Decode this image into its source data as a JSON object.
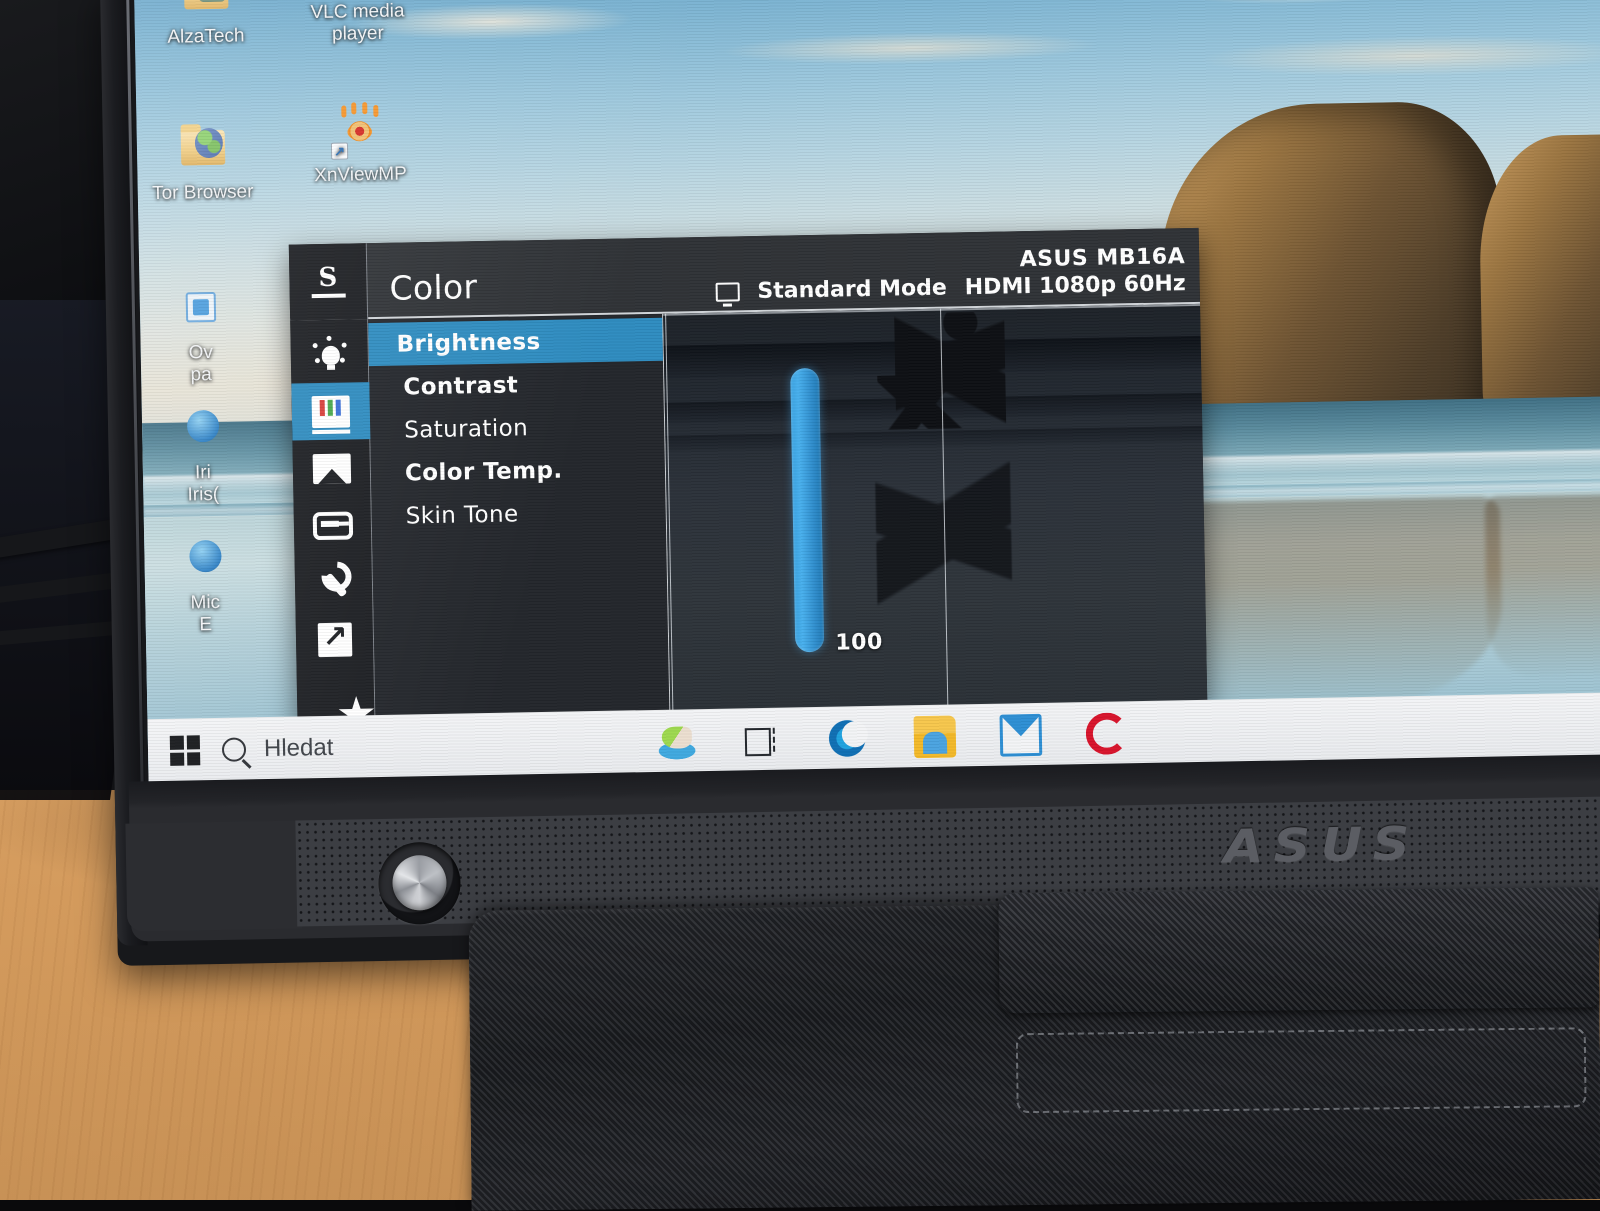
{
  "device": {
    "brand_logo": "ASUS",
    "model_label": "ASUS MB16A"
  },
  "osd": {
    "title": "Color",
    "picture_mode": "Standard Mode",
    "signal": "HDMI  1080p 60Hz",
    "monitor_icon": "monitor-icon",
    "splendid_icon": "s-splendid-icon",
    "rail": [
      {
        "name": "eyecare",
        "icon": "lightbulb-icon",
        "active": false
      },
      {
        "name": "color",
        "icon": "rgb-bars-icon",
        "active": true
      },
      {
        "name": "image",
        "icon": "picture-icon",
        "active": false
      },
      {
        "name": "input-select",
        "icon": "input-arrow-icon",
        "active": false
      },
      {
        "name": "system-setup",
        "icon": "wrench-icon",
        "active": false
      },
      {
        "name": "shortcut",
        "icon": "arrow-up-right-icon",
        "active": false
      },
      {
        "name": "myfavorite",
        "icon": "star-icon",
        "active": false
      }
    ],
    "menu": [
      {
        "label": "Brightness",
        "selected": true,
        "dim": false
      },
      {
        "label": "Contrast",
        "selected": false,
        "dim": false
      },
      {
        "label": "Saturation",
        "selected": false,
        "dim": true
      },
      {
        "label": "Color Temp.",
        "selected": false,
        "dim": false
      },
      {
        "label": "Skin Tone",
        "selected": false,
        "dim": true
      }
    ],
    "slider": {
      "value": "100",
      "min": 0,
      "max": 100,
      "orientation": "vertical",
      "accent_color": "#3aa3e3"
    },
    "highlight_color": "#2e8cc0",
    "panel_bg": "#1c1e22"
  },
  "desktop": {
    "icons": [
      {
        "label": "AlzaTech",
        "icon": "folder-person-icon",
        "shortcut": false
      },
      {
        "label": "VLC media\nplayer",
        "icon": "vlc-cone-icon",
        "shortcut": true
      },
      {
        "label": "Tor Browser",
        "icon": "folder-globe-icon",
        "shortcut": false
      },
      {
        "label": "XnViewMP",
        "icon": "xnview-eye-icon",
        "shortcut": true
      }
    ],
    "partial_icons": [
      {
        "label": "Ov",
        "sublabel": "pa"
      },
      {
        "label": "Iri",
        "sublabel": "Iris("
      },
      {
        "label": "Mic",
        "sublabel": "E"
      }
    ]
  },
  "taskbar": {
    "start_icon": "windows-logo-icon",
    "search_placeholder": "Hledat",
    "search_icon": "search-icon",
    "items": [
      {
        "name": "cortana",
        "icon": "cortana-icon"
      },
      {
        "name": "task-view",
        "icon": "task-view-icon"
      },
      {
        "name": "edge",
        "icon": "edge-icon"
      },
      {
        "name": "explorer",
        "icon": "file-explorer-icon"
      },
      {
        "name": "mail",
        "icon": "mail-icon"
      },
      {
        "name": "opera",
        "icon": "opera-icon"
      }
    ]
  }
}
